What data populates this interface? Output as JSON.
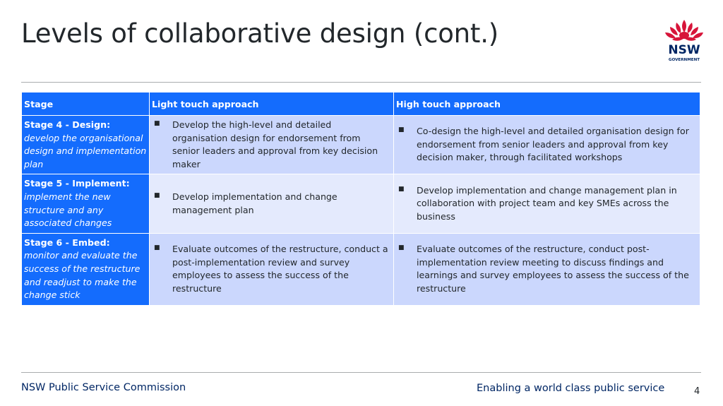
{
  "slide": {
    "title": "Levels of collaborative design (cont.)",
    "logo": {
      "wordmark": "NSW",
      "subtext": "GOVERNMENT",
      "icon": "waratah-icon",
      "colors": {
        "flower": "#d7153a",
        "text": "#002664"
      }
    }
  },
  "table": {
    "headers": [
      "Stage",
      "Light touch approach",
      "High touch approach"
    ],
    "rows": [
      {
        "stage_bold": "Stage 4 - Design:",
        "stage_italic": " develop the organisational design and implementation plan",
        "light": "Develop the high-level and detailed organisation design for endorsement from senior leaders and approval from key decision maker",
        "high": "Co-design the high-level and detailed organisation design for endorsement from senior leaders and approval from key decision maker, through facilitated workshops"
      },
      {
        "stage_bold": "Stage 5 - Implement:",
        "stage_italic": " implement the new structure and any associated changes",
        "light": "Develop implementation and change management plan",
        "high": "Develop implementation and change management plan in collaboration with project team and key SMEs across the business"
      },
      {
        "stage_bold": "Stage 6 - Embed:",
        "stage_italic": " monitor and evaluate the success of the restructure and readjust to make the change stick",
        "light": "Evaluate outcomes of the restructure, conduct a post-implementation review and survey employees to assess the success of the restructure",
        "high": "Evaluate outcomes of the restructure, conduct post-implementation review meeting to discuss findings and learnings and survey employees to assess the success of the restructure"
      }
    ],
    "colors": {
      "header": "#146cfd",
      "row_dark": "#cbd7fd",
      "row_light": "#e4eafd"
    }
  },
  "footer": {
    "left": "NSW Public Service Commission",
    "right": "Enabling a world class public service",
    "page_number": "4"
  }
}
